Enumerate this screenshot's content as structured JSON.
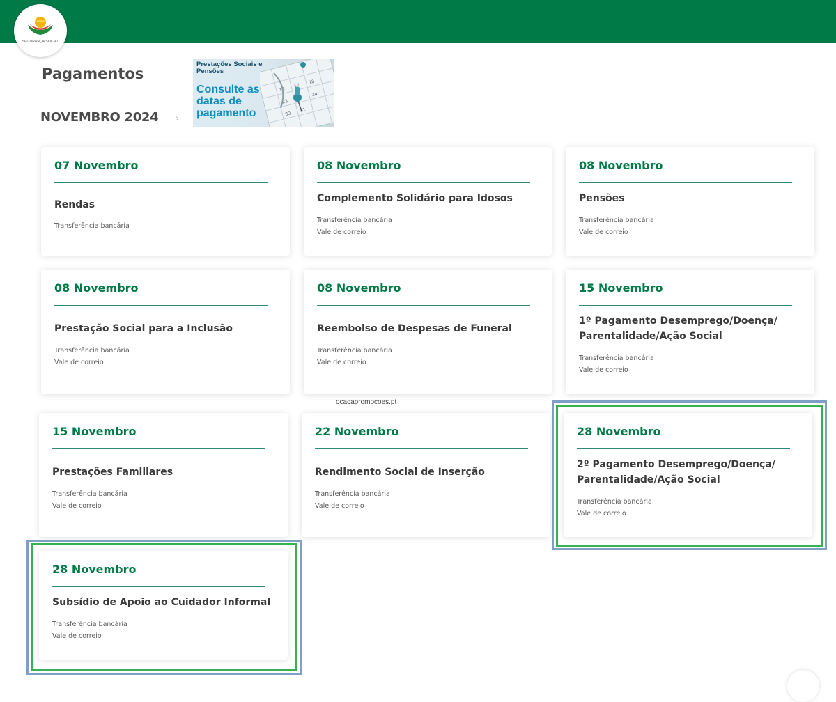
{
  "header": {
    "logo_text": "SEGURANÇA SOCIAL"
  },
  "page": {
    "title": "Pagamentos",
    "month": "NOVEMBRO 2024",
    "month_chevron": "›"
  },
  "banner": {
    "small_text": "Prestações Sociais e Pensões",
    "big_text": "Consulte as datas de pagamento"
  },
  "watermark": "ocacapromocoes.pt",
  "cards": [
    {
      "date": "07 Novembro",
      "title": "Rendas",
      "methods": [
        "Transferência bancária"
      ]
    },
    {
      "date": "08 Novembro",
      "title": "Complemento Solidário para Idosos",
      "methods": [
        "Transferência bancária",
        "Vale de correio"
      ]
    },
    {
      "date": "08 Novembro",
      "title": "Pensões",
      "methods": [
        "Transferência bancária",
        "Vale de correio"
      ]
    },
    {
      "date": "08 Novembro",
      "title": "Prestação Social para a Inclusão",
      "methods": [
        "Transferência bancária",
        "Vale de correio"
      ]
    },
    {
      "date": "08 Novembro",
      "title": "Reembolso de Despesas de Funeral",
      "methods": [
        "Transferência bancária",
        "Vale de correio"
      ]
    },
    {
      "date": "15 Novembro",
      "title": "1º Pagamento Desemprego/Doença/ Parentalidade/Ação Social",
      "methods": [
        "Transferência bancária",
        "Vale de correio"
      ]
    },
    {
      "date": "15 Novembro",
      "title": "Prestações Familiares",
      "methods": [
        "Transferência bancária",
        "Vale de correio"
      ]
    },
    {
      "date": "22 Novembro",
      "title": "Rendimento Social de Inserção",
      "methods": [
        "Transferência bancária",
        "Vale de correio"
      ]
    },
    {
      "date": "28 Novembro",
      "title": "2º Pagamento Desemprego/Doença/ Parentalidade/Ação Social",
      "methods": [
        "Transferência bancária",
        "Vale de correio"
      ]
    },
    {
      "date": "28 Novembro",
      "title": "Subsídio de Apoio ao Cuidador Informal",
      "methods": [
        "Transferência bancária",
        "Vale de correio"
      ]
    }
  ],
  "colors": {
    "brand_green": "#007a46",
    "highlight_green": "#34b254",
    "highlight_blue": "#7e9fc6"
  }
}
